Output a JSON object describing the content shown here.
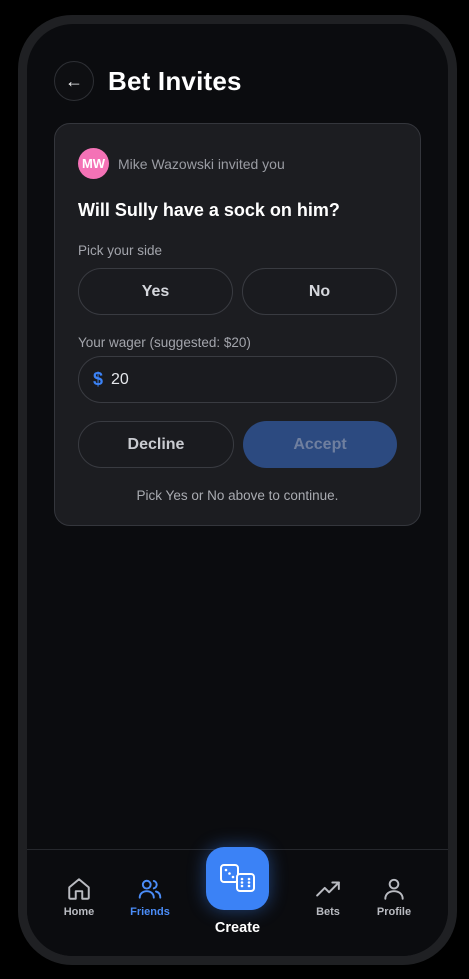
{
  "header": {
    "back_icon": "arrow-left-icon",
    "back_glyph": "←",
    "title": "Bet Invites"
  },
  "invite": {
    "avatar_initials": "MW",
    "avatar_color": "#f472b6",
    "inviter_text": "Mike Wazowski invited you",
    "question": "Will Sully have a sock on him?",
    "pick_side_label": "Pick your side",
    "options": [
      "Yes",
      "No"
    ],
    "wager_label": "Your wager (suggested: $20)",
    "currency_symbol": "$",
    "wager_value": "20",
    "decline_label": "Decline",
    "accept_label": "Accept",
    "hint": "Pick Yes or No above to continue."
  },
  "nav": {
    "items": [
      {
        "label": "Home",
        "icon": "home-icon"
      },
      {
        "label": "Friends",
        "icon": "users-icon"
      },
      {
        "label": "Bets",
        "icon": "trending-up-icon"
      },
      {
        "label": "Profile",
        "icon": "user-icon"
      }
    ],
    "create_label": "Create",
    "create_icon": "dice-icon",
    "active": "Friends"
  },
  "colors": {
    "accent": "#3b82f6",
    "background": "#0b0c0f",
    "card": "#1c1d21"
  }
}
